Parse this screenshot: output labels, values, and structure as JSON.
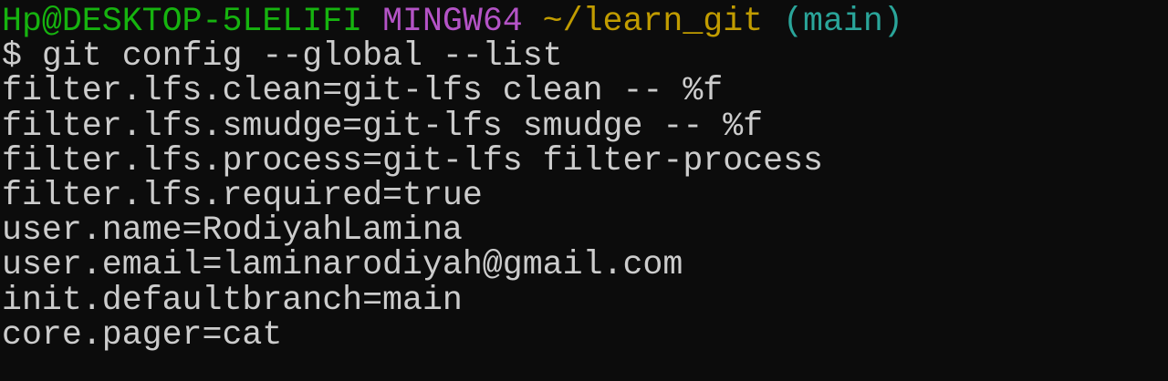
{
  "prompt": {
    "user_host": "Hp@DESKTOP-5LELIFI",
    "system": "MINGW64",
    "path": "~/learn_git",
    "branch": "(main)",
    "colors": {
      "user_host": "#16b30f",
      "system": "#b453c6",
      "path": "#c19c00",
      "branch": "#2aa59a"
    }
  },
  "command": "$ git config --global --list",
  "output": [
    "filter.lfs.clean=git-lfs clean -- %f",
    "filter.lfs.smudge=git-lfs smudge -- %f",
    "filter.lfs.process=git-lfs filter-process",
    "filter.lfs.required=true",
    "user.name=RodiyahLamina",
    "user.email=laminarodiyah@gmail.com",
    "init.defaultbranch=main",
    "core.pager=cat"
  ]
}
